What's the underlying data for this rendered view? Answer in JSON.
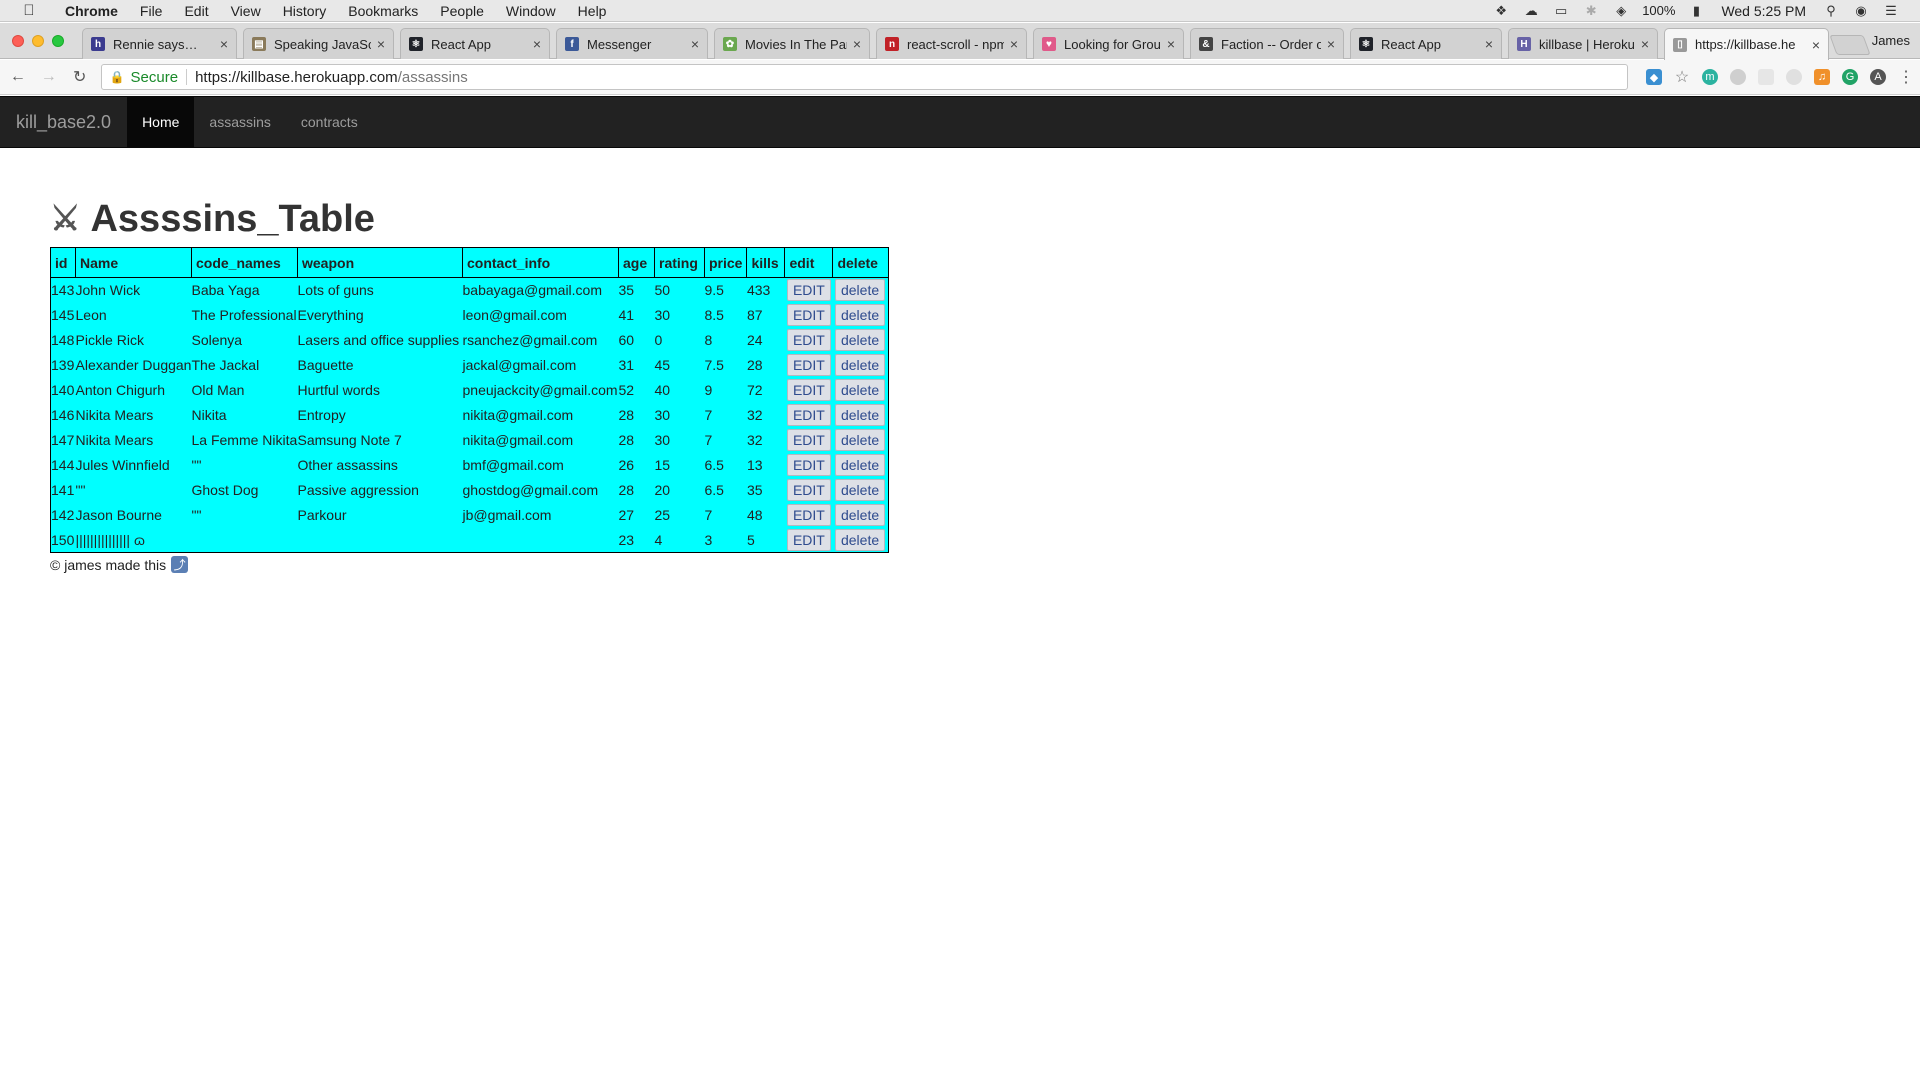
{
  "menubar": {
    "app": "Chrome",
    "items": [
      "File",
      "Edit",
      "View",
      "History",
      "Bookmarks",
      "People",
      "Window",
      "Help"
    ],
    "battery": "100%",
    "clock": "Wed 5:25 PM"
  },
  "tabs": [
    {
      "label": "Rennie says…",
      "favicon": "h",
      "color": "#3b3b8f"
    },
    {
      "label": "Speaking JavaScri",
      "favicon": "book",
      "color": "#8a7a5a"
    },
    {
      "label": "React App",
      "favicon": "react",
      "color": "#20232a"
    },
    {
      "label": "Messenger",
      "favicon": "f",
      "color": "#3b5998"
    },
    {
      "label": "Movies In The Par",
      "favicon": "leaf",
      "color": "#6aa84f"
    },
    {
      "label": "react-scroll - npm",
      "favicon": "n",
      "color": "#c12127"
    },
    {
      "label": "Looking for Group",
      "favicon": "heart",
      "color": "#e05a8a"
    },
    {
      "label": "Faction -- Order o",
      "favicon": "&",
      "color": "#444444"
    },
    {
      "label": "React App",
      "favicon": "react",
      "color": "#20232a"
    },
    {
      "label": "killbase | Heroku",
      "favicon": "H",
      "color": "#6762a6"
    },
    {
      "label": "https://killbase.he",
      "favicon": "page",
      "color": "#999999"
    }
  ],
  "profile": "James",
  "address": {
    "secure_label": "Secure",
    "url_host": "https://killbase.herokuapp.com",
    "url_path": "/assassins"
  },
  "navbar": {
    "brand": "kill_base2.0",
    "links": [
      "Home",
      "assassins",
      "contracts"
    ]
  },
  "page": {
    "title": "Assssins_Table",
    "title_icon": "⚔",
    "footer": "© james made this"
  },
  "table": {
    "headers": [
      "id",
      "Name",
      "code_names",
      "weapon",
      "contact_info",
      "age",
      "rating",
      "price",
      "kills",
      "edit",
      "delete"
    ],
    "edit_label": "EDIT",
    "delete_label": "delete",
    "rows": [
      [
        "143",
        "John Wick",
        "Baba Yaga",
        "Lots of guns",
        "babayaga@gmail.com",
        "35",
        "50",
        "9.5",
        "433"
      ],
      [
        "145",
        "Leon",
        "The Professional",
        "Everything",
        "leon@gmail.com",
        "41",
        "30",
        "8.5",
        "87"
      ],
      [
        "148",
        "Pickle Rick",
        "Solenya",
        "Lasers and office supplies",
        "rsanchez@gmail.com",
        "60",
        "0",
        "8",
        "24"
      ],
      [
        "139",
        "Alexander Duggan",
        "The Jackal",
        "Baguette",
        "jackal@gmail.com",
        "31",
        "45",
        "7.5",
        "28"
      ],
      [
        "140",
        "Anton Chigurh",
        "Old Man",
        "Hurtful words",
        "pneujackcity@gmail.com",
        "52",
        "40",
        "9",
        "72"
      ],
      [
        "146",
        "Nikita Mears",
        "Nikita",
        "Entropy",
        "nikita@gmail.com",
        "28",
        "30",
        "7",
        "32"
      ],
      [
        "147",
        "Nikita Mears",
        "La Femme Nikita",
        "Samsung Note 7",
        "nikita@gmail.com",
        "28",
        "30",
        "7",
        "32"
      ],
      [
        "144",
        "Jules Winnfield",
        "\"\"",
        "Other assassins",
        "bmf@gmail.com",
        "26",
        "15",
        "6.5",
        "13"
      ],
      [
        "141",
        "\"\"",
        "Ghost Dog",
        "Passive aggression",
        "ghostdog@gmail.com",
        "28",
        "20",
        "6.5",
        "35"
      ],
      [
        "142",
        "Jason Bourne",
        "\"\"",
        "Parkour",
        "jb@gmail.com",
        "27",
        "25",
        "7",
        "48"
      ],
      [
        "150",
        "||||||||||||||| ɷ",
        "",
        "",
        "",
        "23",
        "4",
        "3",
        "5"
      ]
    ]
  }
}
